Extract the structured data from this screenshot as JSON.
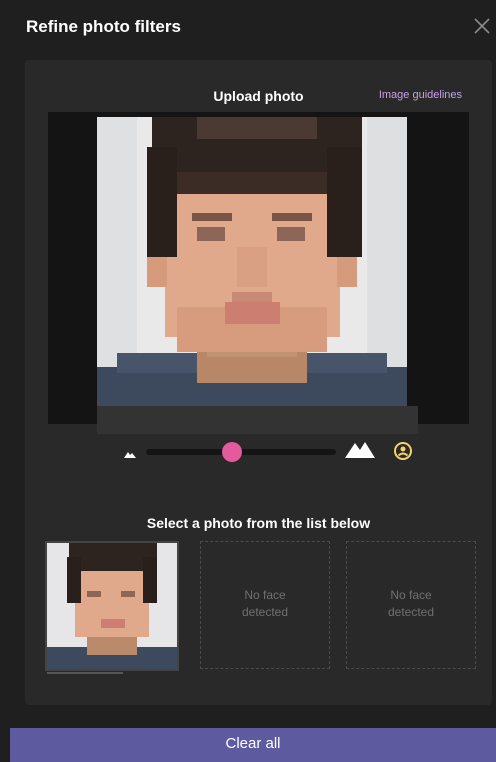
{
  "dialog": {
    "title": "Refine photo filters",
    "close_icon": "close-icon"
  },
  "upload": {
    "title": "Upload photo",
    "guidelines_link": "Image guidelines"
  },
  "zoom": {
    "min_icon": "mountain-small-icon",
    "max_icon": "mountain-large-icon",
    "reset_icon": "reset-icon",
    "value": 0.45
  },
  "selection": {
    "title": "Select a photo from the list below",
    "slots": [
      {
        "type": "photo",
        "selected": true
      },
      {
        "type": "empty",
        "label_line1": "No face",
        "label_line2": "detected"
      },
      {
        "type": "empty",
        "label_line1": "No face",
        "label_line2": "detected"
      }
    ]
  },
  "footer": {
    "clear_label": "Clear all"
  },
  "colors": {
    "accent": "#e35a9d",
    "link": "#c6a0e8",
    "footer": "#5e5aa0",
    "panel": "#292929",
    "background": "#1f1f1f"
  }
}
